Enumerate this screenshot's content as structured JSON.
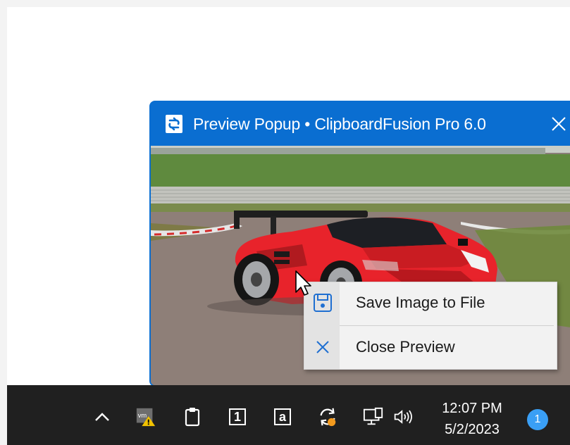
{
  "popup": {
    "title": "Preview Popup • ClipboardFusion Pro 6.0",
    "app_icon": "clipboardfusion-icon",
    "close_icon": "close-icon"
  },
  "context_menu": {
    "items": [
      {
        "label": "Save Image to File",
        "icon": "floppy-disk-icon"
      },
      {
        "label": "Close Preview",
        "icon": "close-icon"
      }
    ]
  },
  "taskbar": {
    "tray_icons": [
      "chevron-up-icon",
      "vmware-warning-icon",
      "clipboard-icon",
      "box-1-icon",
      "box-a-icon",
      "sync-icon",
      "network-icon",
      "speaker-icon"
    ],
    "box1_glyph": "1",
    "boxa_glyph": "a",
    "time": "12:07 PM",
    "date": "5/2/2023",
    "notification_count": "1"
  },
  "colors": {
    "accent": "#0a6ed1",
    "taskbar": "#202020",
    "badge": "#3a9ff5",
    "car": "#e8232b"
  }
}
